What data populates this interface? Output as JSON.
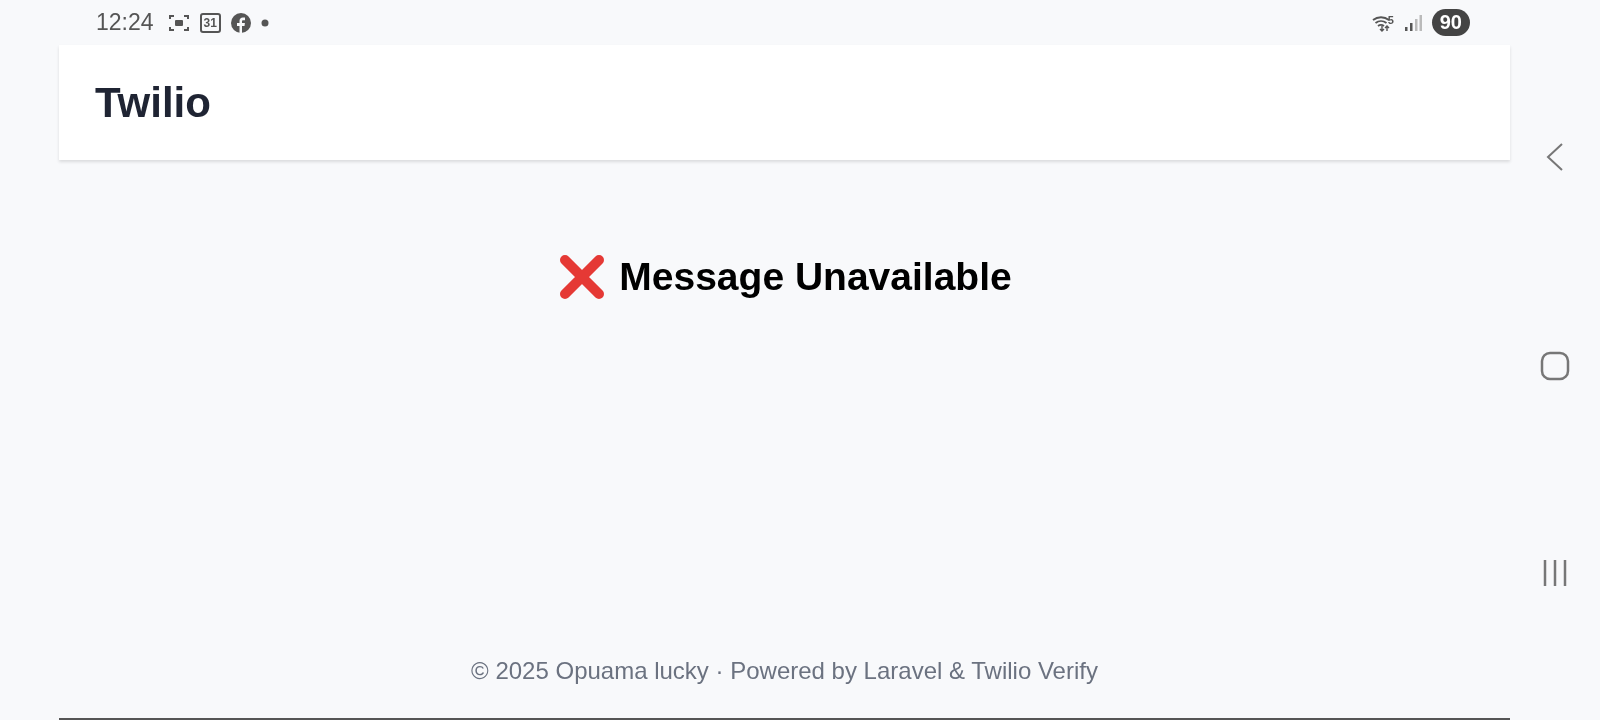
{
  "status_bar": {
    "time": "12:24",
    "calendar_day": "31",
    "wifi_band": "5",
    "battery": "90"
  },
  "header": {
    "title": "Twilio"
  },
  "message": {
    "title": "Message Unavailable"
  },
  "footer": {
    "text": "© 2025 Opuama lucky · Powered by Laravel & Twilio Verify"
  }
}
